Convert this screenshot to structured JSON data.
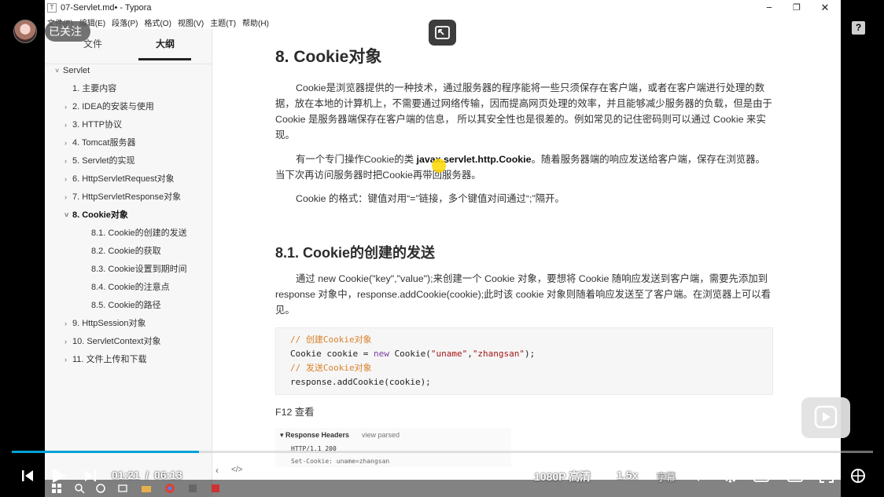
{
  "window": {
    "title": "07-Servlet.md• - Typora",
    "icon_label": "T",
    "minimize": "−",
    "restore": "❐",
    "close": "✕"
  },
  "menu": [
    "文件(F)",
    "编辑(E)",
    "段落(P)",
    "格式(O)",
    "视图(V)",
    "主题(T)",
    "帮助(H)"
  ],
  "sidebar": {
    "tab_files": "文件",
    "tab_outline": "大纲",
    "outline": [
      {
        "label": "Servlet",
        "caret": "˅",
        "active": false
      },
      {
        "label": "1. 主要内容",
        "caret": "",
        "active": false
      },
      {
        "label": "2. IDEA的安装与使用",
        "caret": "›",
        "active": false
      },
      {
        "label": "3. HTTP协议",
        "caret": "›",
        "active": false
      },
      {
        "label": "4. Tomcat服务器",
        "caret": "›",
        "active": false
      },
      {
        "label": "5. Servlet的实现",
        "caret": "›",
        "active": false
      },
      {
        "label": "6. HttpServletRequest对象",
        "caret": "›",
        "active": false
      },
      {
        "label": "7. HttpServletResponse对象",
        "caret": "›",
        "active": false
      },
      {
        "label": "8. Cookie对象",
        "caret": "˅",
        "active": true
      },
      {
        "label": "8.1. Cookie的创建的发送",
        "caret": "",
        "active": false
      },
      {
        "label": "8.2. Cookie的获取",
        "caret": "",
        "active": false
      },
      {
        "label": "8.3. Cookie设置到期时间",
        "caret": "",
        "active": false
      },
      {
        "label": "8.4. Cookie的注意点",
        "caret": "",
        "active": false
      },
      {
        "label": "8.5. Cookie的路径",
        "caret": "",
        "active": false
      },
      {
        "label": "9. HttpSession对象",
        "caret": "›",
        "active": false
      },
      {
        "label": "10. ServletContext对象",
        "caret": "›",
        "active": false
      },
      {
        "label": "11. 文件上传和下载",
        "caret": "›",
        "active": false
      }
    ]
  },
  "editor": {
    "h2": "8. Cookie对象",
    "p1": "Cookie是浏览器提供的一种技术，通过服务器的程序能将一些只须保存在客户端，或者在客户端进行处理的数据，放在本地的计算机上，不需要通过网络传输，因而提高网页处理的效率，并且能够减少服务器的负载，但是由于 Cookie 是服务器端保存在客户端的信息， 所以其安全性也是很差的。例如常见的记住密码则可以通过 Cookie 来实现。",
    "p2_before": "有一个专门操作Cookie的类 ",
    "p2_bold": "javax.servlet.http.Cookie",
    "p2_after": "。随着服务器端的响应发送给客户端，保存在浏览器。当下次再访问服务器时把Cookie再带回服务器。",
    "p3": "Cookie 的格式：键值对用“=”链接，多个键值对间通过“;”隔开。",
    "h3": "8.1. Cookie的创建的发送",
    "p4": "通过 new Cookie(\"key\",\"value\");来创建一个 Cookie 对象，要想将 Cookie 随响应发送到客户端，需要先添加到 response 对象中，response.addCookie(cookie);此时该 cookie 对象则随着响应发送至了客户端。在浏览器上可以看见。",
    "code": {
      "c1": "// 创建Cookie对象",
      "l2a": "Cookie cookie = ",
      "l2kw": "new",
      "l2b": " Cookie(",
      "l2s1": "\"uname\"",
      "l2c": ",",
      "l2s2": "\"zhangsan\"",
      "l2d": ");",
      "c3": "// 发送Cookie对象",
      "l4": "response.addCookie(cookie);"
    },
    "f12": "F12 查看",
    "devtools": {
      "header": "▾ Response Headers",
      "parsed": "view parsed",
      "status": "HTTP/1.1 200",
      "setcookie": "Set-Cookie: uname=zhangsan"
    },
    "source_toggle": "</>"
  },
  "player": {
    "follow_label": "已关注",
    "help": "?",
    "time_current": "01:21",
    "time_sep": "/",
    "time_total": "06:13",
    "progress": 0.217,
    "quality": "1080P 高清",
    "speed": "1.5x",
    "subtitle": "字幕",
    "accent": "#00a1d6"
  }
}
